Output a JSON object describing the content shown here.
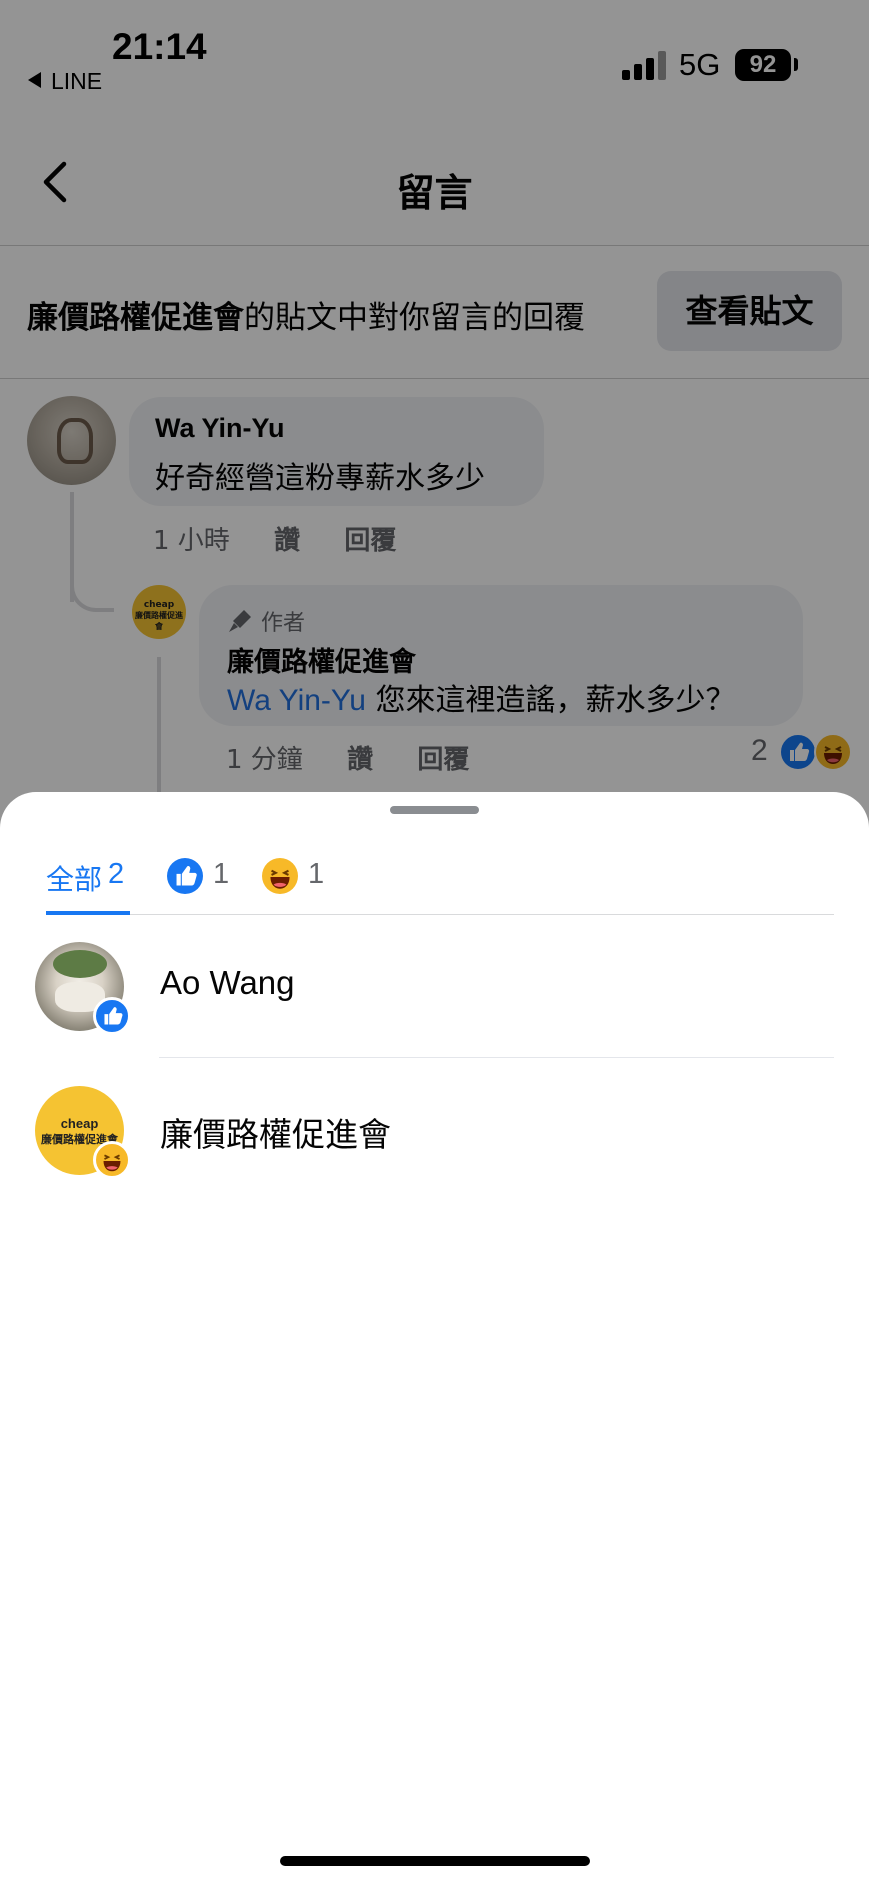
{
  "status_bar": {
    "time": "21:14",
    "back_app": "LINE",
    "network": "5G",
    "battery": "92"
  },
  "header": {
    "title": "留言",
    "back_icon": "chevron-left-icon"
  },
  "context": {
    "page_name": "廉價路權促進會",
    "text": "的貼文中對你留言的回覆",
    "view_post_label": "查看貼文"
  },
  "comment": {
    "author": "Wa Yin-Yu",
    "text": "好奇經營這粉專薪水多少",
    "time": "1 小時",
    "like_label": "讚",
    "reply_label": "回覆"
  },
  "reply": {
    "author_badge": "作者",
    "author": "廉價路權促進會",
    "mention": "Wa Yin-Yu",
    "text": " 您來這裡造謠，薪水多少？",
    "time": "1 分鐘",
    "like_label": "讚",
    "reply_label": "回覆",
    "reaction_count": "2",
    "avatar_line1": "cheap",
    "avatar_line2": "廉價路權促進會"
  },
  "reactions_sheet": {
    "tabs": [
      {
        "label": "全部",
        "count": "2"
      },
      {
        "icon": "like-icon",
        "count": "1"
      },
      {
        "icon": "haha-icon",
        "count": "1"
      }
    ],
    "users": [
      {
        "name": "Ao Wang",
        "reaction": "like-icon"
      },
      {
        "name": "廉價路權促進會",
        "reaction": "haha-icon",
        "avatar_line1": "cheap",
        "avatar_line2": "廉價路權促進會"
      }
    ]
  },
  "colors": {
    "accent": "#1877f2",
    "haha": "#f7b928",
    "avatar_org": "#f5c332",
    "mention": "#216fdb"
  }
}
